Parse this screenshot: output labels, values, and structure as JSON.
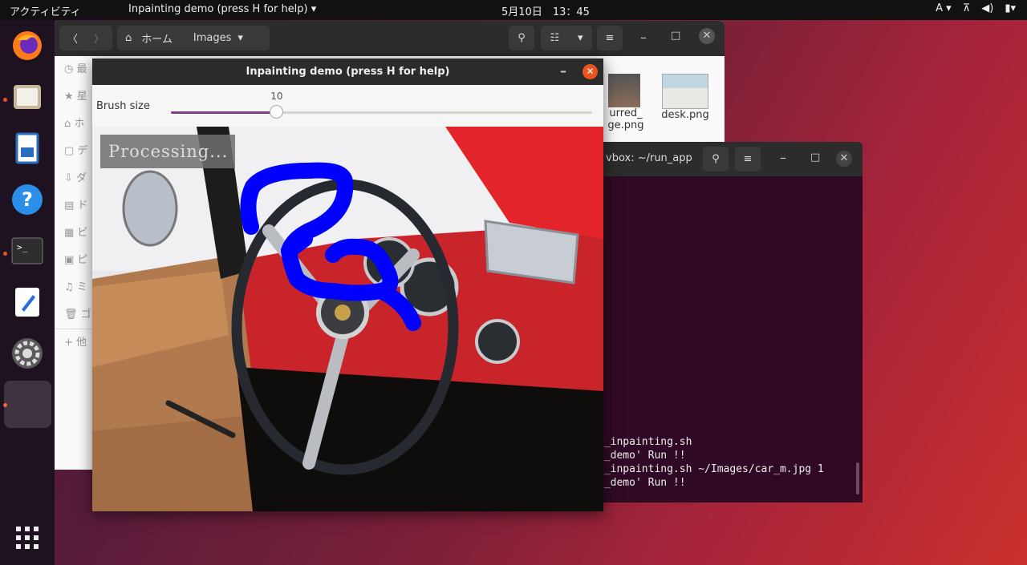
{
  "topbar": {
    "activities": "アクティビティ",
    "app_menu": "Inpainting demo (press H for help)",
    "clock": "5月10日　13：45",
    "input_method": "A"
  },
  "dock": {
    "items": [
      "firefox-icon",
      "files-icon",
      "writer-icon",
      "help-icon",
      "terminal-icon",
      "text-editor-icon",
      "settings-icon",
      "app-window-icon"
    ],
    "show_apps_icon": "apps-grid-icon"
  },
  "files": {
    "location_home": "ホーム",
    "location_images": "Images",
    "sidebar": [
      "最",
      "星",
      "ホ",
      "デ",
      "ダ",
      "ド",
      "ビ",
      "ピ",
      "ミ",
      "ゴ"
    ],
    "other_locations": "+ 他",
    "thumbs": [
      {
        "label1": "urred_",
        "label2": "ge.png"
      },
      {
        "label1": "desk.png",
        "label2": ""
      }
    ]
  },
  "terminal": {
    "title": "vbox: ~/run_app",
    "lines": [
      "e_inpainting.sh",
      "g_demo' Run !!",
      "e_inpainting.sh ~/Images/car_m.jpg 1",
      "g_demo' Run !!"
    ]
  },
  "inpaint": {
    "title": "Inpainting demo (press H for help)",
    "brush_label": "Brush size",
    "brush_value": "10",
    "brush_fraction": 0.25,
    "processing": "Processing..."
  },
  "colors": {
    "accent": "#e95420",
    "slider": "#7b3f83",
    "mask": "#0000ff",
    "car_red": "#e11a1a"
  }
}
